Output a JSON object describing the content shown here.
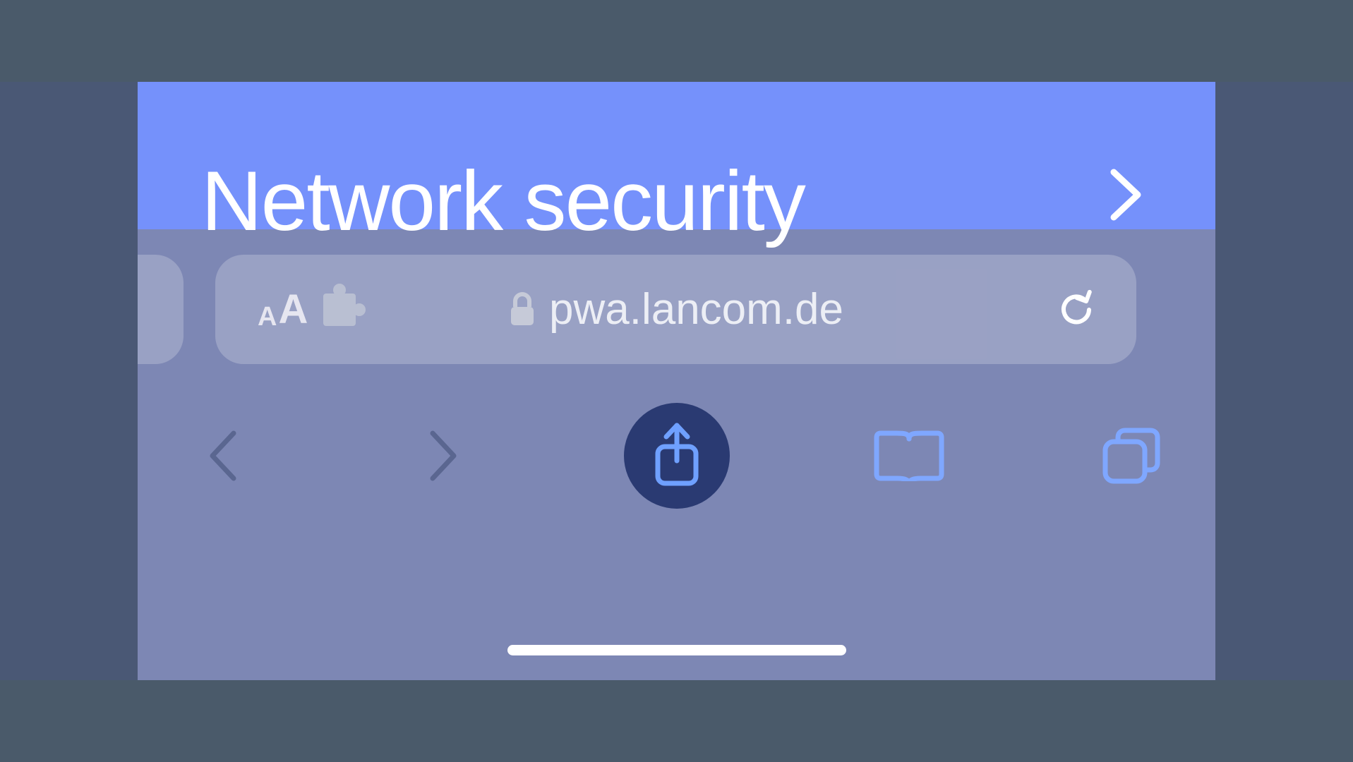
{
  "page": {
    "heading": "Network security"
  },
  "address_bar": {
    "text_size_label": "AA",
    "url": "pwa.lancom.de"
  },
  "icons": {
    "chevron_right": "chevron-right",
    "extension": "puzzle",
    "lock": "lock",
    "reload": "reload",
    "back": "chevron-left",
    "forward": "chevron-right",
    "share": "share",
    "bookmarks": "book-open",
    "tabs": "tabs"
  },
  "colors": {
    "banner": "#7591fb",
    "chrome_overlay": "#7d87b4",
    "accent": "#6fa0ff"
  }
}
